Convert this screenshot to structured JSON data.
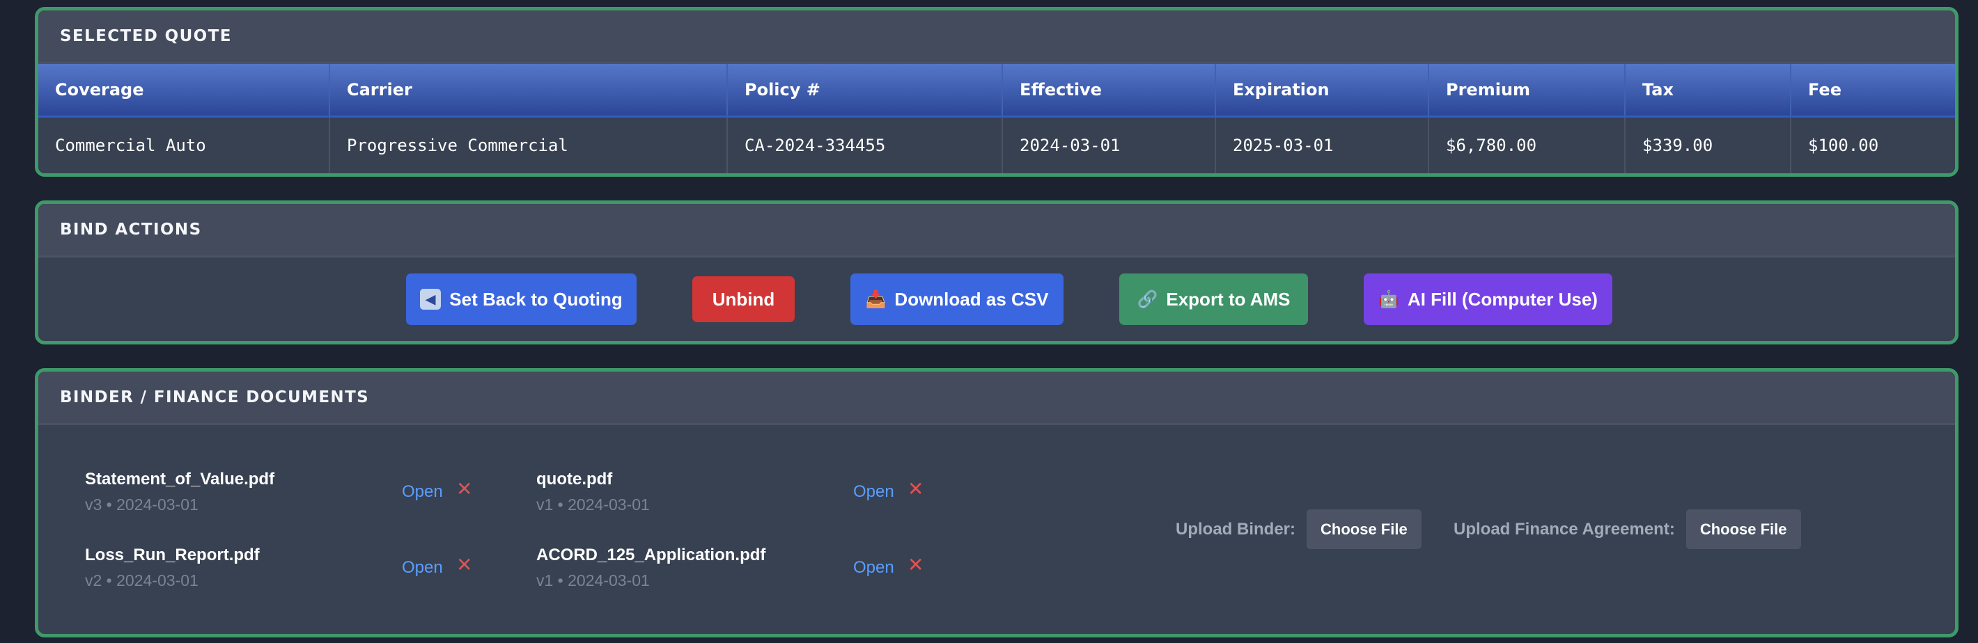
{
  "selected_quote": {
    "header": "SELECTED QUOTE",
    "columns": [
      "Coverage",
      "Carrier",
      "Policy #",
      "Effective",
      "Expiration",
      "Premium",
      "Tax",
      "Fee"
    ],
    "row": [
      "Commercial Auto",
      "Progressive Commercial",
      "CA-2024-334455",
      "2024-03-01",
      "2025-03-01",
      "$6,780.00",
      "$339.00",
      "$100.00"
    ]
  },
  "bind_actions": {
    "header": "BIND ACTIONS",
    "buttons": {
      "set_back": {
        "label": "Set Back to Quoting",
        "icon": "back-arrow-icon",
        "color": "#3a66e0"
      },
      "unbind": {
        "label": "Unbind",
        "color": "#d13535"
      },
      "download_csv": {
        "label": "Download as CSV",
        "icon": "inbox-tray-icon",
        "color": "#3a66e0"
      },
      "export_ams": {
        "label": "Export to AMS",
        "icon": "link-icon",
        "color": "#3e9369"
      },
      "ai_fill": {
        "label": "AI Fill (Computer Use)",
        "icon": "robot-icon",
        "color": "#7642e6"
      }
    }
  },
  "documents": {
    "header": "BINDER / FINANCE DOCUMENTS",
    "open_label": "Open",
    "items": [
      {
        "name": "Statement_of_Value.pdf",
        "meta": "v3 • 2024-03-01"
      },
      {
        "name": "quote.pdf",
        "meta": "v1 • 2024-03-01"
      },
      {
        "name": "Loss_Run_Report.pdf",
        "meta": "v2 • 2024-03-01"
      },
      {
        "name": "ACORD_125_Application.pdf",
        "meta": "v1 • 2024-03-01"
      }
    ],
    "upload_binder": {
      "label": "Upload Binder:",
      "button": "Choose File"
    },
    "upload_finance": {
      "label": "Upload Finance Agreement:",
      "button": "Choose File"
    }
  },
  "colors": {
    "card_border": "#3f9a6a",
    "link": "#5c9dff",
    "delete": "#e05252"
  }
}
